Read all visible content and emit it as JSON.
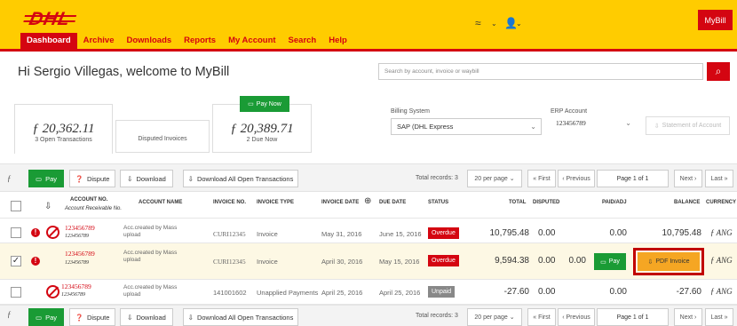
{
  "header": {
    "logo": "DHL",
    "mybill_label": "MyBill",
    "nav": [
      "Dashboard",
      "Archive",
      "Downloads",
      "Reports",
      "My Account",
      "Search",
      "Help"
    ]
  },
  "welcome": "Hi Sergio Villegas, welcome to MyBill",
  "search": {
    "placeholder": "Search by account, invoice or waybill"
  },
  "cards": {
    "open": {
      "amount": "ƒ 20,362.11",
      "sub": "3 Open Transactions"
    },
    "disputed": {
      "label": "Disputed Invoices"
    },
    "due": {
      "pay_now": "Pay Now",
      "amount": "ƒ 20,389.71",
      "sub": "2 Due Now"
    }
  },
  "billing": {
    "system_label": "Billing System",
    "system_value": "SAP (DHL Express",
    "erp_label": "ERP Account",
    "erp_value": "123456789",
    "statement_label": "Statement of Account"
  },
  "toolbar": {
    "symbol": "ƒ",
    "pay": "Pay",
    "dispute": "Dispute",
    "download": "Download",
    "download_all": "Download All Open Transactions",
    "total_records": "Total records: 3",
    "per_page": "20 per page",
    "first": "« First",
    "previous": "‹ Previous",
    "page": "Page 1 of 1",
    "next": "Next ›",
    "last": "Last »"
  },
  "columns": {
    "account_no": "ACCOUNT NO.",
    "account_recv": "Account Receivable No.",
    "account_name": "ACCOUNT NAME",
    "invoice_no": "INVOICE NO.",
    "invoice_type": "INVOICE TYPE",
    "invoice_date": "INVOICE DATE",
    "due_date": "DUE DATE",
    "status": "STATUS",
    "total": "TOTAL",
    "disputed": "DISPUTED",
    "paid": "PAID/ADJ",
    "balance": "BALANCE",
    "currency": "CURRENCY"
  },
  "rows": [
    {
      "account": "123456789",
      "recv": "123456789",
      "name": "Acc.created by Mass upload",
      "invoice_no": "CURI12345",
      "type": "Invoice",
      "invoice_date": "May 31, 2016",
      "due_date": "June 15, 2016",
      "status": "Overdue",
      "total": "10,795.48",
      "disputed": "0.00",
      "paid": "0.00",
      "balance": "10,795.48",
      "currency": "ƒ ANG"
    },
    {
      "account": "123456789",
      "recv": "123456789",
      "name": "Acc.created by Mass upload",
      "invoice_no": "CURI12345",
      "type": "Invoice",
      "invoice_date": "April 30, 2016",
      "due_date": "May 15, 2016",
      "status": "Overdue",
      "total": "9,594.38",
      "disputed": "0.00",
      "paid": "0.00",
      "pay": "Pay",
      "pdf": "PDF Invoice",
      "currency": "ƒ ANG"
    },
    {
      "account": "123456789",
      "recv": "123456789",
      "name": "Acc.created by Mass upload",
      "invoice_no": "141001602",
      "type": "Unapplied Payments",
      "invoice_date": "April 25, 2016",
      "due_date": "April 25, 2016",
      "status": "Unpaid",
      "total": "-27.60",
      "disputed": "0.00",
      "paid": "0.00",
      "balance": "-27.60",
      "currency": "ƒ ANG"
    }
  ],
  "colors": {
    "brand_yellow": "#ffcc00",
    "brand_red": "#d40511",
    "green": "#1a9b35",
    "overdue": "#d40511",
    "unpaid": "#888888"
  }
}
